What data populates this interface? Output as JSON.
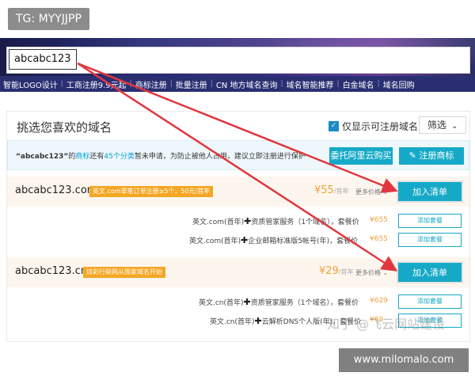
{
  "tg_label": "TG: MYYJJPP",
  "search": {
    "value": "abcabc123"
  },
  "nav": {
    "items": [
      "智能LOGO设计",
      "工商注册9.9元起",
      "商标注册",
      "批量注册",
      "CN 地方域名查询",
      "域名智能推荐",
      "白金域名",
      "域名回购"
    ],
    "separator": "|"
  },
  "card": {
    "title": "挑选您喜欢的域名",
    "only_registrable": "仅显示可注册域名",
    "only_registrable_checked": true,
    "filter_label": "筛选"
  },
  "notice": {
    "quote": "“abcabc123”",
    "de": "的",
    "trademark_word": "商标",
    "still_have": "还有",
    "categories": "45个分类",
    "rest": "暂未申请，为防止被他人占用，建议立即注册进行保护",
    "entrust_button": "委托阿里云购买",
    "register_trademark_button": "注册商标"
  },
  "results": [
    {
      "domain": "abcabc123.com",
      "tag": "英文.com單笔订单注册≥5个，50元/首年",
      "price": "¥55",
      "price_unit": "/首年",
      "more_price": "更多价格",
      "add_button": "加入清单",
      "bundles": [
        {
          "prefix": "英文.com(首年)",
          "item": "资质管家服务（1个域名）",
          "suffix": "，套餐价",
          "price": "¥655",
          "button": "添加套餐"
        },
        {
          "prefix": "英文.com(首年)",
          "item": "企业邮箱标准版5帐号(年)",
          "suffix": "，套餐价",
          "price": "¥655",
          "button": "添加套餐"
        }
      ]
    },
    {
      "domain": "abcabc123.cn",
      "tag": "炫彩行联网从国家域名开始",
      "price": "¥29",
      "price_unit": "/首年",
      "more_price": "更多价格",
      "add_button": "加入清单",
      "bundles": [
        {
          "prefix": "英文.cn(首年)",
          "item": "资质管家服务（1个域名）",
          "suffix": "，套餐价",
          "price": "¥629",
          "button": "添加套餐"
        },
        {
          "prefix": "英文.cn(首年)",
          "item": "云解析DNS个人版(年)",
          "suffix": "，套餐价",
          "price": "¥69",
          "button": "添加套餐"
        }
      ]
    }
  ],
  "watermark": "知乎 @飞云网站建设",
  "site_badge": "www.milomalo.com",
  "colors": {
    "accent": "#16a9c7",
    "price": "#f0a13a",
    "tag": "#f5a623",
    "arrow": "#e0373f",
    "nav_bg": "#2a2f72"
  }
}
